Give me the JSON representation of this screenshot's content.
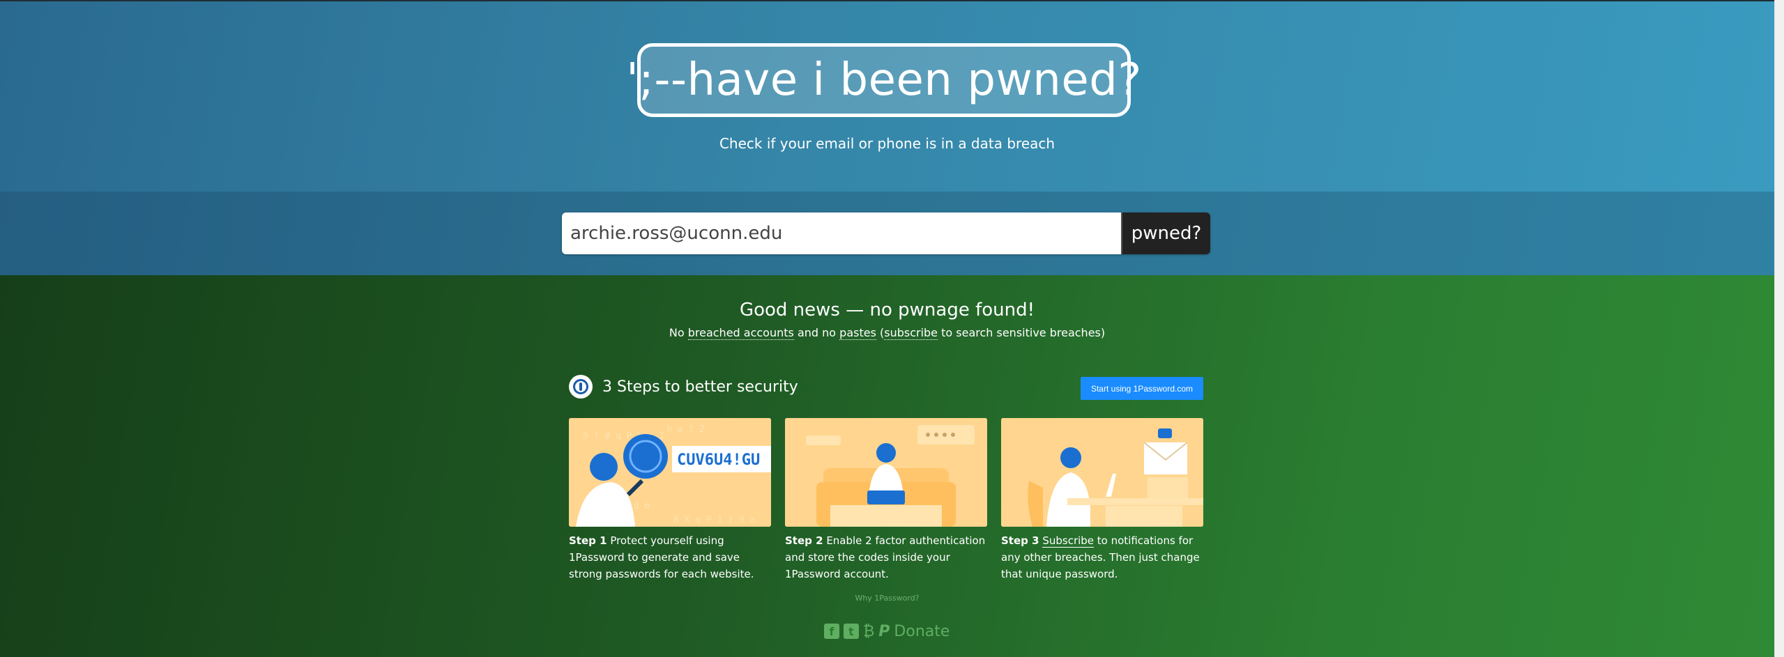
{
  "header": {
    "logo_text": "';--have i been pwned?",
    "tagline": "Check if your email or phone is in a data breach"
  },
  "search": {
    "value": "archie.ross@uconn.edu",
    "button_label": "pwned?"
  },
  "result": {
    "title": "Good news — no pwnage found!",
    "sub_prefix": "No ",
    "breached_accounts": "breached accounts",
    "sub_mid": " and no ",
    "pastes": "pastes",
    "sub_paren_open": " (",
    "subscribe": "subscribe",
    "sub_suffix": " to search sensitive breaches)"
  },
  "steps": {
    "heading": "3 Steps to better security",
    "cta": "Start using 1Password.com",
    "items": [
      {
        "label": "Step 1",
        "text": " Protect yourself using 1Password to generate and save strong passwords for each website.",
        "image_text": "CUV6U4!GU"
      },
      {
        "label": "Step 2",
        "text": " Enable 2 factor authentication and store the codes inside your 1Password account."
      },
      {
        "label": "Step 3",
        "link": "Subscribe",
        "text": " to notifications for any other breaches. Then just change that unique password."
      }
    ],
    "why": "Why 1Password?"
  },
  "footer": {
    "donate": "Donate"
  },
  "colors": {
    "accent_button": "#1a8cff",
    "card_bg": "#ffd58f",
    "figure_blue": "#1a6fd1"
  }
}
